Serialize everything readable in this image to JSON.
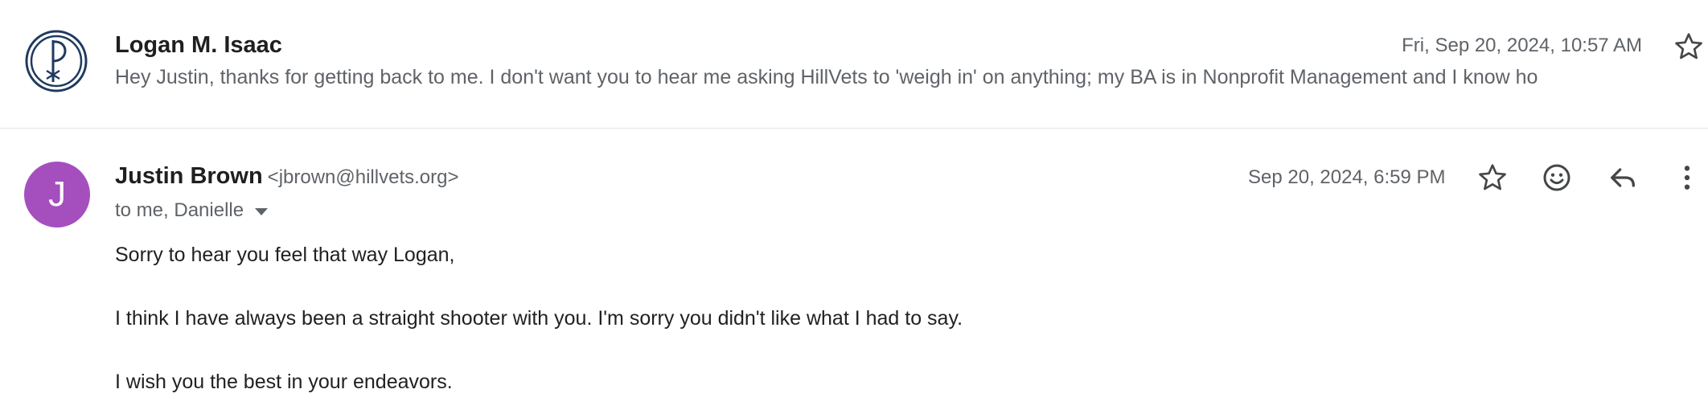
{
  "messages": [
    {
      "sender": "Logan M. Isaac",
      "date": "Fri, Sep 20, 2024, 10:57 AM",
      "snippet": "Hey Justin, thanks for getting back to me. I don't want you to hear me asking HillVets to 'weigh in' on anything; my BA is in Nonprofit Management and I know ho",
      "avatar_icon": "chi-rho-logo-icon"
    },
    {
      "avatar_letter": "J",
      "avatar_color": "#a54fbf",
      "sender": "Justin Brown",
      "email": "<jbrown@hillvets.org>",
      "recipients": "to me, Danielle",
      "date": "Sep 20, 2024, 6:59 PM",
      "body": [
        "Sorry to hear you feel that way Logan,",
        "I think I have always been a straight shooter with you. I'm sorry you didn't like what I had to say.",
        "I wish you the best in your endeavors."
      ]
    }
  ],
  "icons": [
    "star-icon",
    "emoji-icon",
    "reply-icon",
    "more-vert-icon",
    "chevron-down-icon"
  ]
}
